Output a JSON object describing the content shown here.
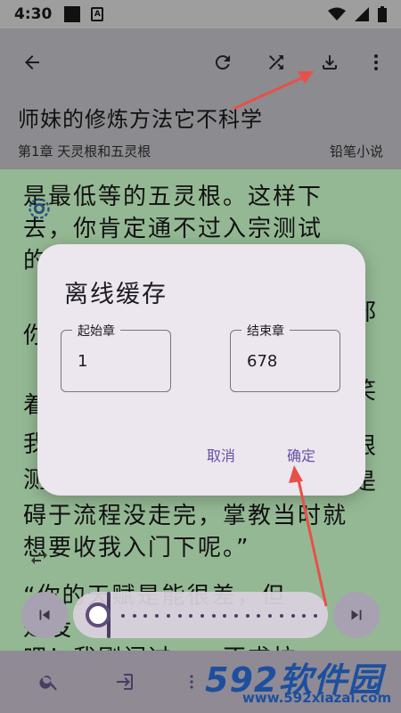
{
  "status": {
    "time": "4:30",
    "a_badge": "A"
  },
  "app_bar": {
    "book_title": "师妹的修炼方法它不科学",
    "chapter_title": "第1章 天灵根和五灵根",
    "source_name": "铅笔小说"
  },
  "reader": {
    "lines": [
      "是最低等的五灵根。这样下",
      "去，你肯定通不过入宗测试",
      "的",
      "你",
      "着",
      "我",
      "测",
      "碍于流程没走完，掌教当时就",
      "想要收我入门下呢。”",
      "“你的天赋是能很差，但",
      "是没",
      "吧！我刚闪过……不求拉"
    ],
    "right_fragments": [
      "邪",
      "笑",
      "根",
      "是"
    ]
  },
  "dialog": {
    "title": "离线缓存",
    "start_label": "起始章",
    "start_value": "1",
    "end_label": "结束章",
    "end_value": "678",
    "cancel_label": "取消",
    "confirm_label": "确定"
  },
  "watermark": {
    "main": "592软件园",
    "sub": "www.592xiazai.com"
  },
  "colors": {
    "accent": "#6750a4",
    "arrow": "#e8504a",
    "reader_bg": "#94b894",
    "dialog_bg": "#ece6ee"
  },
  "icons": [
    "back-arrow-icon",
    "refresh-icon",
    "shuffle-icon",
    "download-icon",
    "more-vert-icon",
    "search-icon",
    "exit-icon",
    "menu-icon",
    "skip-next-icon",
    "skip-previous-icon"
  ]
}
